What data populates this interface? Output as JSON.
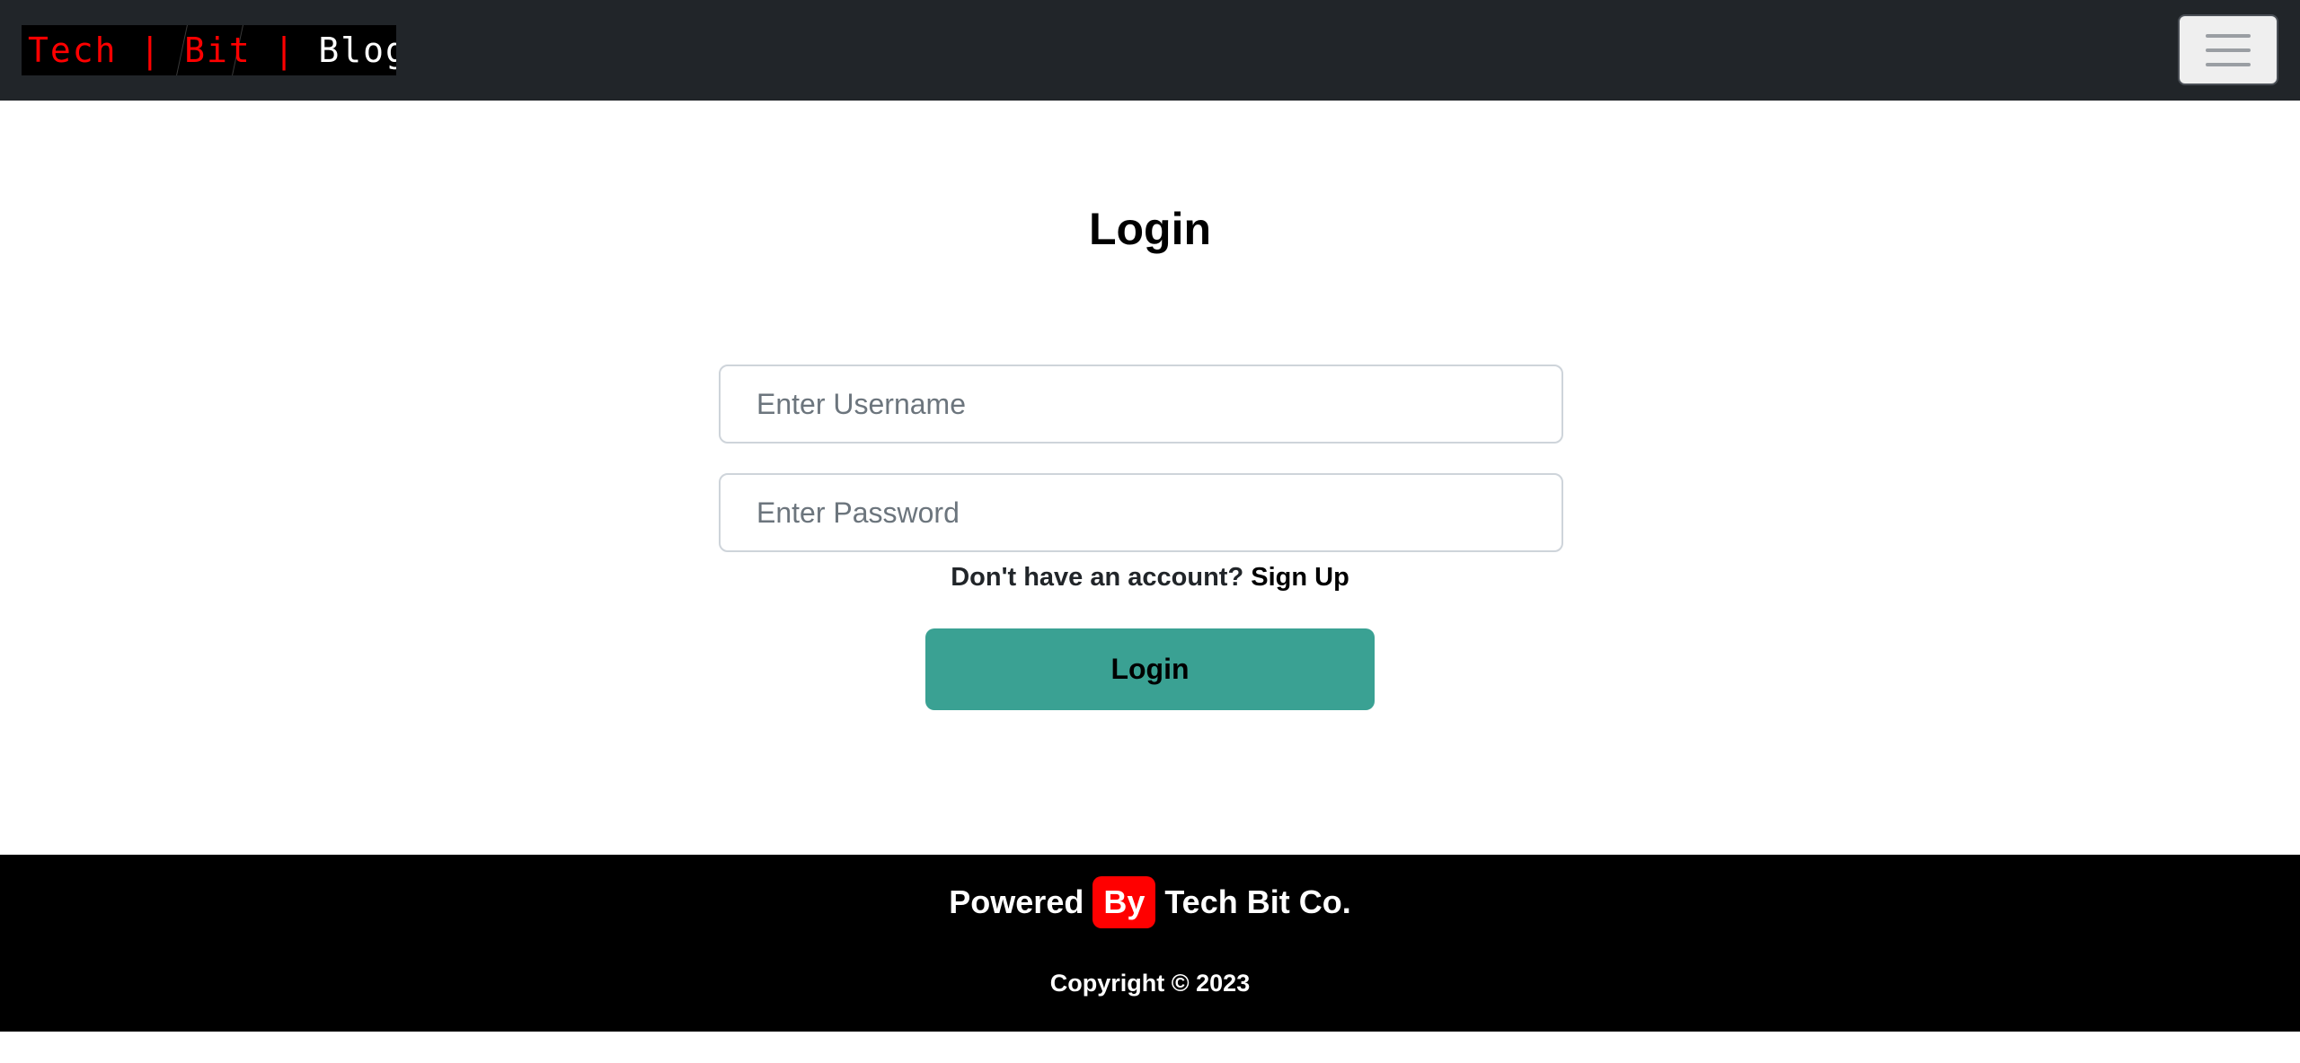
{
  "navbar": {
    "brand": {
      "part1": "Tech | Bit | ",
      "part2": "Blog",
      "accent_color": "#ff0000"
    },
    "menu_icon": "hamburger-menu-icon"
  },
  "login": {
    "title": "Login",
    "username_placeholder": "Enter Username",
    "password_placeholder": "Enter Password",
    "signup_prompt": "Don't have an account?",
    "signup_link": "Sign Up",
    "button_label": "Login",
    "button_color": "#3aa193"
  },
  "footer": {
    "powered": "Powered",
    "by": "By",
    "company": "Tech Bit Co.",
    "badge_color": "#ff0000",
    "copyright": "Copyright © 2023"
  }
}
